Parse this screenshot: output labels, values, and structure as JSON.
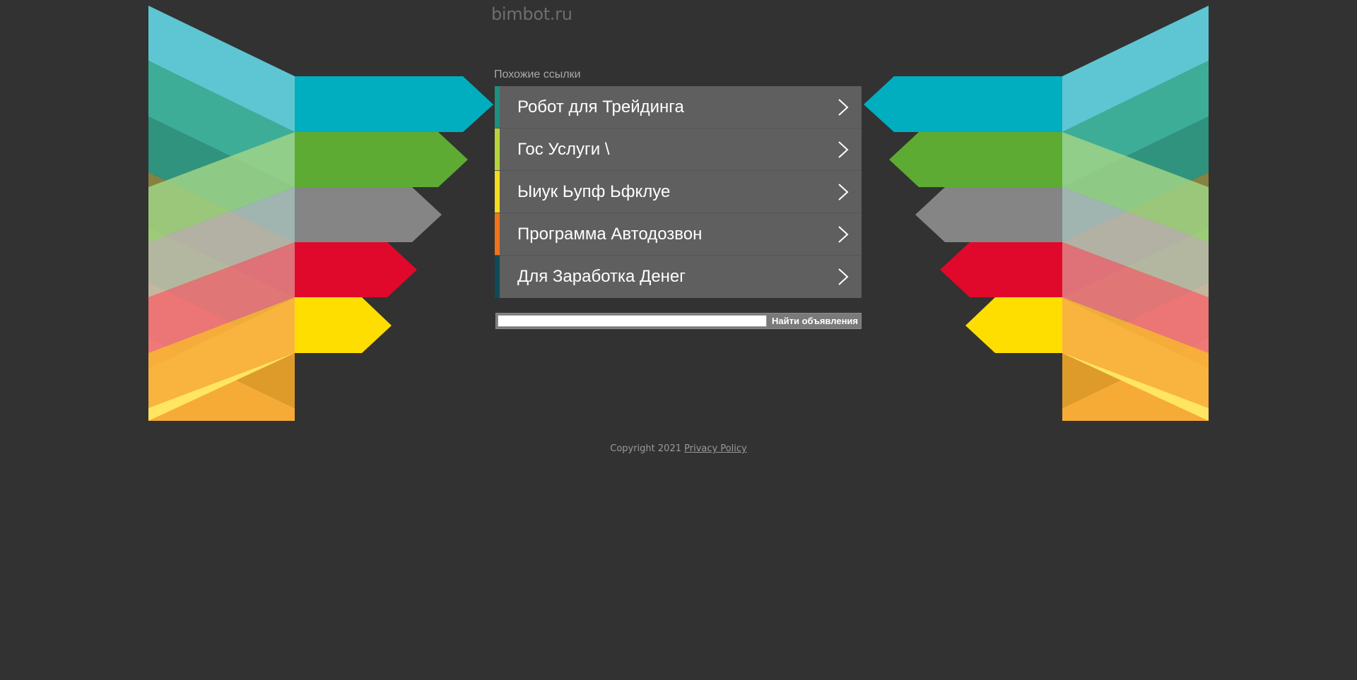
{
  "site": {
    "domain": "bimbot.ru"
  },
  "related": {
    "title": "Похожие ссылки",
    "links": [
      {
        "label": "Робот для Трейдинга",
        "stripe_color": "#1e8f7e",
        "icon": "chevron-right-icon"
      },
      {
        "label": "Гос Услуги \\",
        "stripe_color": "#b7d53b",
        "icon": "chevron-right-icon"
      },
      {
        "label": "Ыиук Ьупф Ьфклуе",
        "stripe_color": "#f5dc1f",
        "icon": "chevron-right-icon"
      },
      {
        "label": "Программа Автодозвон",
        "stripe_color": "#f0731c",
        "icon": "chevron-right-icon"
      },
      {
        "label": "Для Заработка Денег",
        "stripe_color": "#0f4a57",
        "icon": "chevron-right-icon"
      }
    ]
  },
  "search": {
    "value": "",
    "button_label": "Найти объявления"
  },
  "footer": {
    "copyright": "Copyright 2021",
    "privacy_label": "Privacy Policy"
  },
  "colors": {
    "background": "#323232",
    "row_background": "#5f5f5f",
    "band_cyan": "#00aec0",
    "band_green": "#5dab32",
    "band_gray": "#858585",
    "band_red": "#e0092b",
    "band_yellow": "#fedd00"
  }
}
